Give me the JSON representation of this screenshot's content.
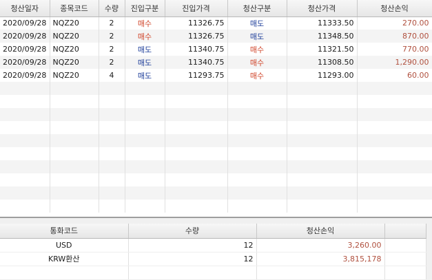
{
  "positions": {
    "columns": [
      "청산일자",
      "종목코드",
      "수량",
      "진입구분",
      "진입가격",
      "청산구분",
      "청산가격",
      "청산손익"
    ],
    "rows": [
      {
        "date": "2020/09/28",
        "code": "NQZ20",
        "qty": "2",
        "entry_side": "매수",
        "entry_price": "11326.75",
        "exit_side": "매도",
        "exit_price": "11333.50",
        "pnl": "270.00"
      },
      {
        "date": "2020/09/28",
        "code": "NQZ20",
        "qty": "2",
        "entry_side": "매수",
        "entry_price": "11326.75",
        "exit_side": "매도",
        "exit_price": "11348.50",
        "pnl": "870.00"
      },
      {
        "date": "2020/09/28",
        "code": "NQZ20",
        "qty": "2",
        "entry_side": "매도",
        "entry_price": "11340.75",
        "exit_side": "매수",
        "exit_price": "11321.50",
        "pnl": "770.00"
      },
      {
        "date": "2020/09/28",
        "code": "NQZ20",
        "qty": "2",
        "entry_side": "매도",
        "entry_price": "11340.75",
        "exit_side": "매수",
        "exit_price": "11308.50",
        "pnl": "1,290.00"
      },
      {
        "date": "2020/09/28",
        "code": "NQZ20",
        "qty": "4",
        "entry_side": "매도",
        "entry_price": "11293.75",
        "exit_side": "매수",
        "exit_price": "11293.00",
        "pnl": "60.00"
      }
    ]
  },
  "summary": {
    "columns": [
      "통화코드",
      "수량",
      "청산손익"
    ],
    "rows": [
      {
        "currency": "USD",
        "qty": "12",
        "pnl": "3,260.00"
      },
      {
        "currency": "KRW환산",
        "qty": "12",
        "pnl": "3,815,178"
      }
    ]
  },
  "colors": {
    "buy": "#d0452a",
    "sell": "#1f3f9a",
    "pnl": "#b0503e"
  }
}
